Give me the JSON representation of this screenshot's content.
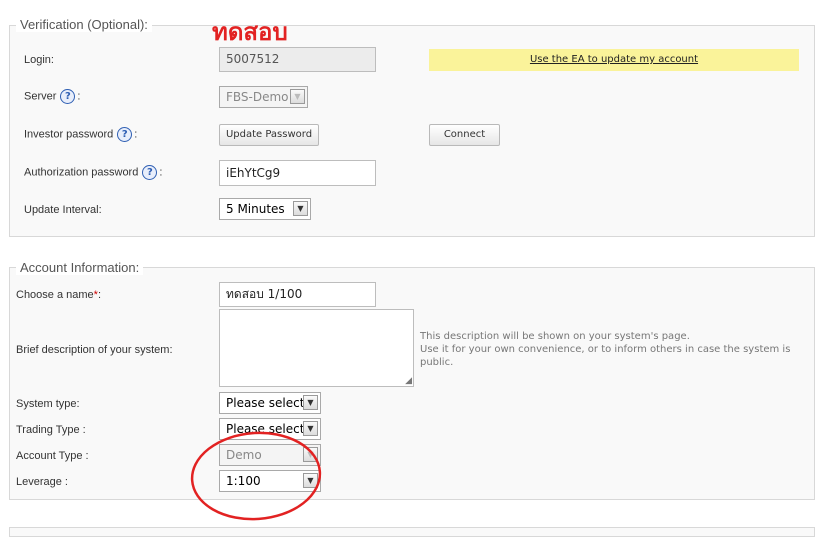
{
  "verification": {
    "legend": "Verification (Optional):",
    "annotation_text": "ทดสอบ",
    "login_label": "Login:",
    "login_value": "5007512",
    "notice_link": "Use the EA to update my account",
    "server_label": "Server",
    "server_value": "FBS-Demo",
    "investor_label": "Investor password",
    "update_password_button": "Update Password",
    "connect_button": "Connect",
    "auth_label": "Authorization password",
    "auth_value": "iEhYtCg9",
    "interval_label": "Update Interval:",
    "interval_value": "5 Minutes",
    "help_glyph": "?",
    "colon": ":"
  },
  "account": {
    "legend": "Account Information:",
    "name_label": "Choose a name",
    "required_mark": "*",
    "name_colon": ":",
    "name_value": "ทดสอบ 1/100",
    "desc_label": "Brief description of your system:",
    "desc_hint_1": "This description will be shown on your system's page.",
    "desc_hint_2": "Use it for your own convenience, or to inform others in case the system is",
    "desc_hint_3": "public.",
    "system_type_label": "System type:",
    "system_type_value": "Please select",
    "trading_type_label": "Trading Type :",
    "trading_type_value": "Please select",
    "account_type_label": "Account Type :",
    "account_type_value": "Demo",
    "leverage_label": "Leverage :",
    "leverage_value": "1:100"
  },
  "colors": {
    "annotation_red": "#e22222",
    "notice_yellow": "#faf39a"
  }
}
